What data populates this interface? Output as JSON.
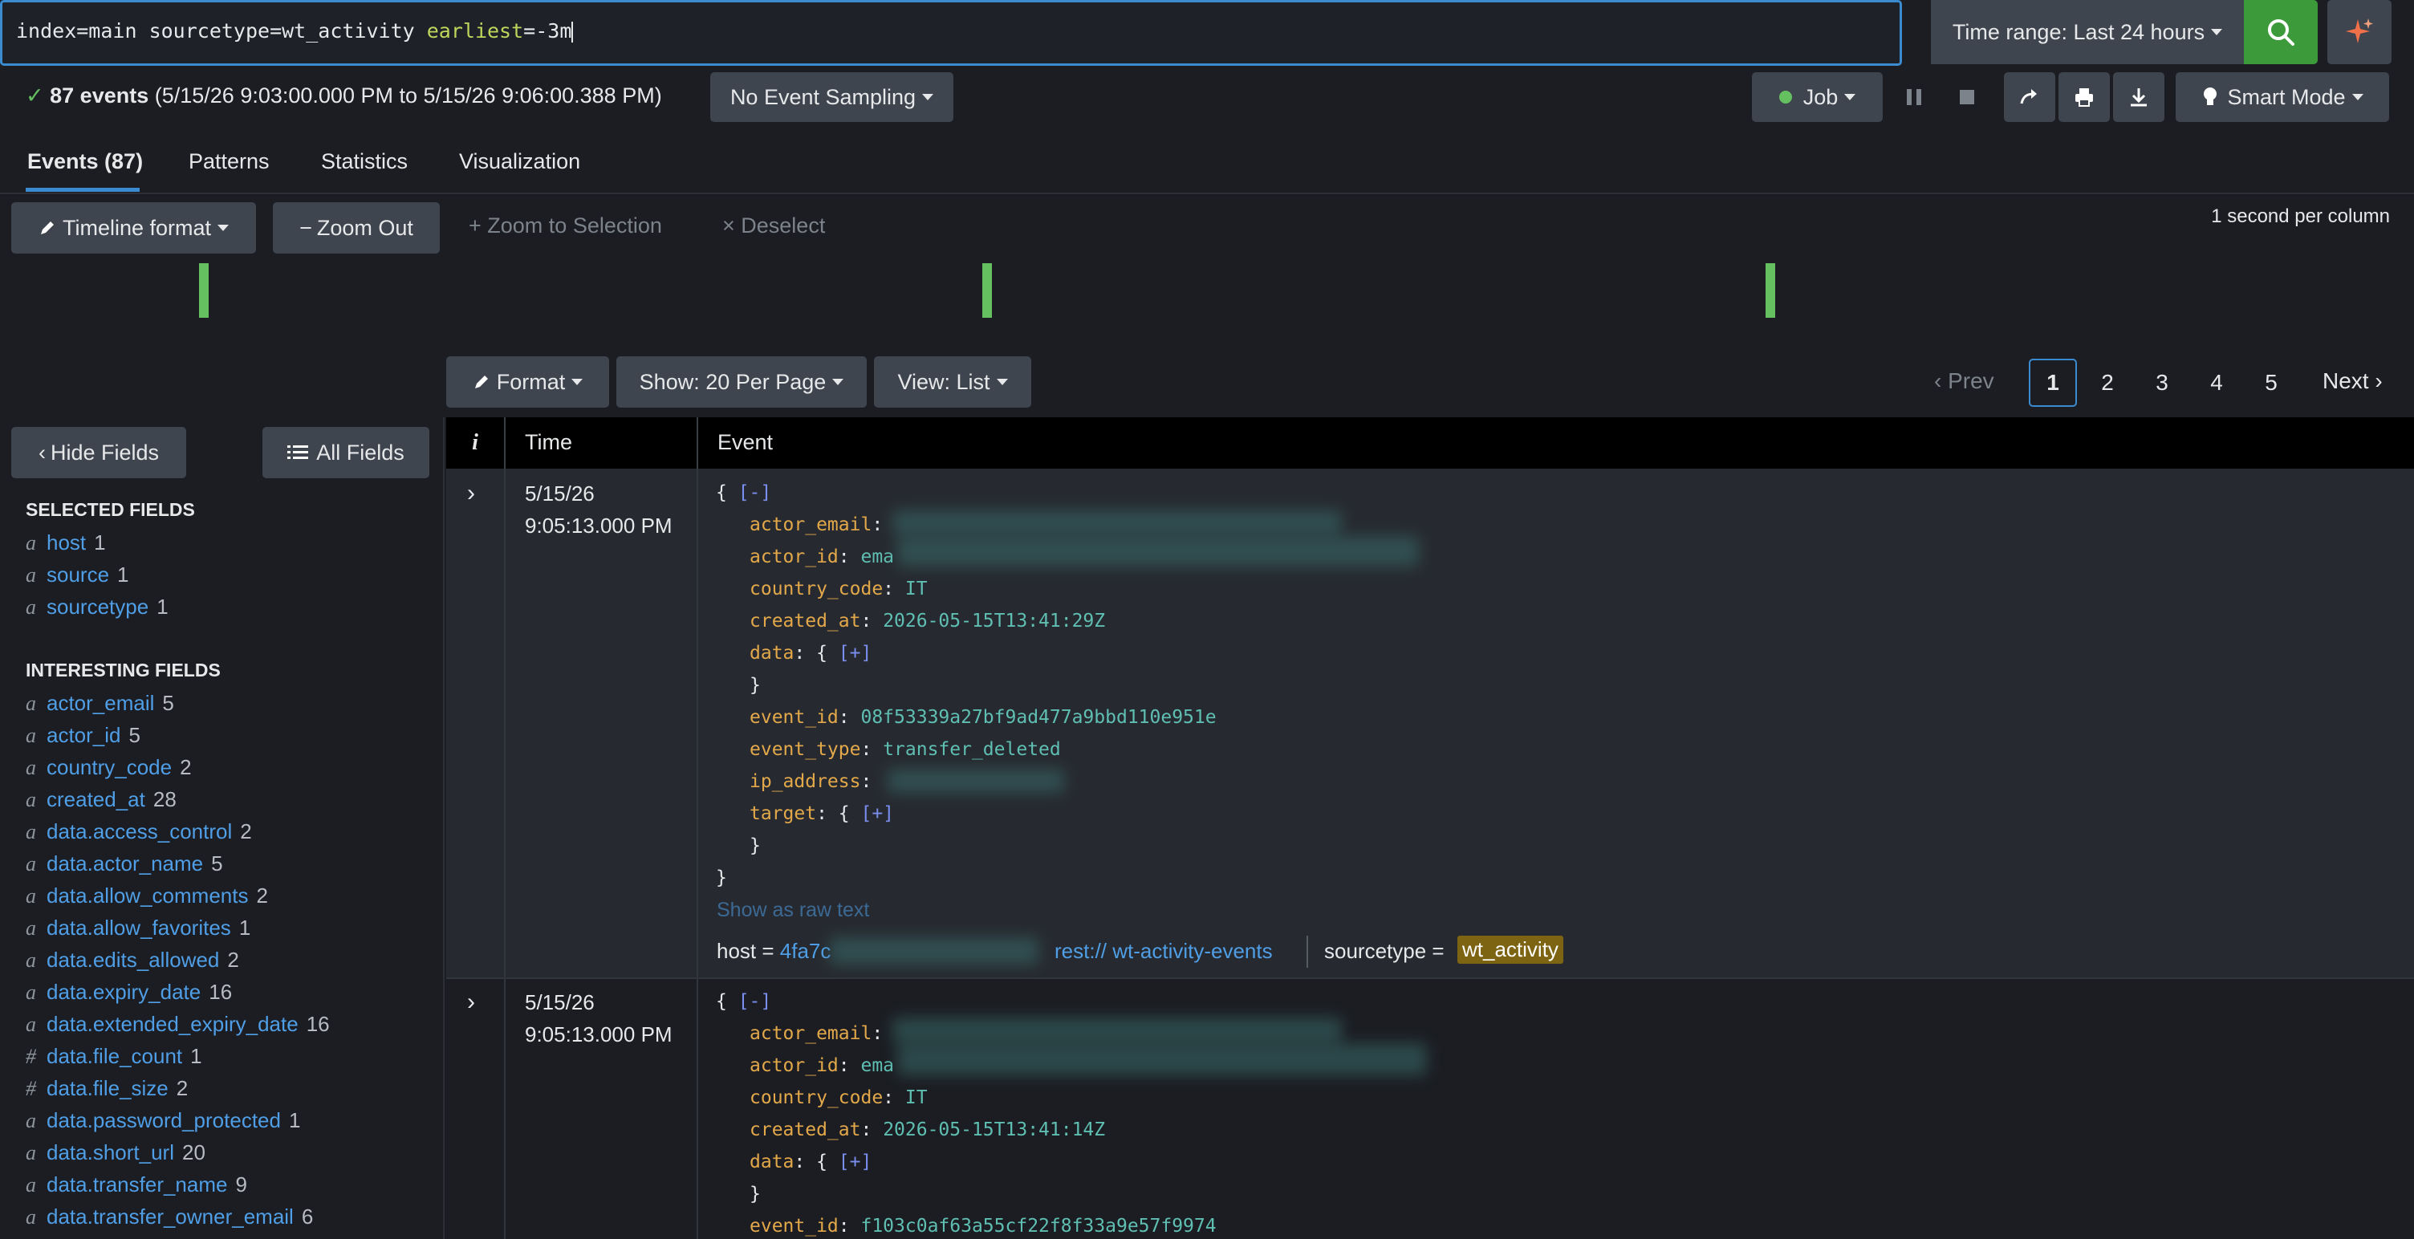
{
  "search": {
    "query_plain": "index=main sourcetype=wt_activity ",
    "query_kw": "earliest",
    "query_val": "=-3m",
    "time_range": "Time range: Last 24 hours"
  },
  "status": {
    "check": "✓",
    "count": "87 events",
    "range": "(5/15/26 9:03:00.000 PM to 5/15/26 9:06:00.388 PM)",
    "sampling": "No Event Sampling",
    "job": "Job",
    "smart_mode": "Smart Mode"
  },
  "tabs": [
    "Events (87)",
    "Patterns",
    "Statistics",
    "Visualization"
  ],
  "timeline": {
    "format": "Timeline format",
    "zoom_out": "Zoom Out",
    "zoom_sel": "Zoom to Selection",
    "deselect": "Deselect",
    "per_column": "1 second per column"
  },
  "toolbar": {
    "format": "Format",
    "show": "Show: 20 Per Page",
    "view": "View: List",
    "prev": "Prev",
    "next": "Next",
    "pages": [
      "1",
      "2",
      "3",
      "4",
      "5"
    ]
  },
  "sidebar": {
    "hide": "Hide Fields",
    "all": "All Fields",
    "selected_title": "SELECTED FIELDS",
    "interesting_title": "INTERESTING FIELDS",
    "selected": [
      {
        "t": "a",
        "n": "host",
        "c": "1"
      },
      {
        "t": "a",
        "n": "source",
        "c": "1"
      },
      {
        "t": "a",
        "n": "sourcetype",
        "c": "1"
      }
    ],
    "interesting": [
      {
        "t": "a",
        "n": "actor_email",
        "c": "5"
      },
      {
        "t": "a",
        "n": "actor_id",
        "c": "5"
      },
      {
        "t": "a",
        "n": "country_code",
        "c": "2"
      },
      {
        "t": "a",
        "n": "created_at",
        "c": "28"
      },
      {
        "t": "a",
        "n": "data.access_control",
        "c": "2"
      },
      {
        "t": "a",
        "n": "data.actor_name",
        "c": "5"
      },
      {
        "t": "a",
        "n": "data.allow_comments",
        "c": "2"
      },
      {
        "t": "a",
        "n": "data.allow_favorites",
        "c": "1"
      },
      {
        "t": "a",
        "n": "data.edits_allowed",
        "c": "2"
      },
      {
        "t": "a",
        "n": "data.expiry_date",
        "c": "16"
      },
      {
        "t": "a",
        "n": "data.extended_expiry_date",
        "c": "16"
      },
      {
        "t": "#",
        "n": "data.file_count",
        "c": "1"
      },
      {
        "t": "#",
        "n": "data.file_size",
        "c": "2"
      },
      {
        "t": "a",
        "n": "data.password_protected",
        "c": "1"
      },
      {
        "t": "a",
        "n": "data.short_url",
        "c": "20"
      },
      {
        "t": "a",
        "n": "data.transfer_name",
        "c": "9"
      },
      {
        "t": "a",
        "n": "data.transfer_owner_email",
        "c": "6"
      }
    ]
  },
  "table": {
    "col_i": "i",
    "col_time": "Time",
    "col_event": "Event"
  },
  "events": [
    {
      "date": "5/15/26",
      "time": "9:05:13.000 PM",
      "open": "{ ",
      "collapse": "[-]",
      "actor_email_key": "actor_email",
      "actor_id_key": "actor_id",
      "actor_id_val": "ema",
      "country_key": "country_code",
      "country_val": "IT",
      "created_key": "created_at",
      "created_val": "2026-05-15T13:41:29Z",
      "data_key": "data",
      "expand": "[+]",
      "event_id_key": "event_id",
      "event_id_val": "08f53339a27bf9ad477a9bbd110e951e",
      "event_type_key": "event_type",
      "event_type_val": "transfer_deleted",
      "ip_key": "ip_address",
      "target_key": "target",
      "close": "}",
      "raw": "Show as raw text",
      "host_label": "host = ",
      "host_val": "4fa7c",
      "source_val": "rest:// wt-activity-events",
      "st_label": "sourcetype = ",
      "st_val": "wt_activity"
    },
    {
      "date": "5/15/26",
      "time": "9:05:13.000 PM",
      "open": "{ ",
      "collapse": "[-]",
      "actor_email_key": "actor_email",
      "actor_id_key": "actor_id",
      "actor_id_val": "ema",
      "country_key": "country_code",
      "country_val": "IT",
      "created_key": "created_at",
      "created_val": "2026-05-15T13:41:14Z",
      "data_key": "data",
      "expand": "[+]",
      "event_id_key": "event_id",
      "event_id_val": "f103c0af63a55cf22f8f33a9e57f9974"
    }
  ]
}
